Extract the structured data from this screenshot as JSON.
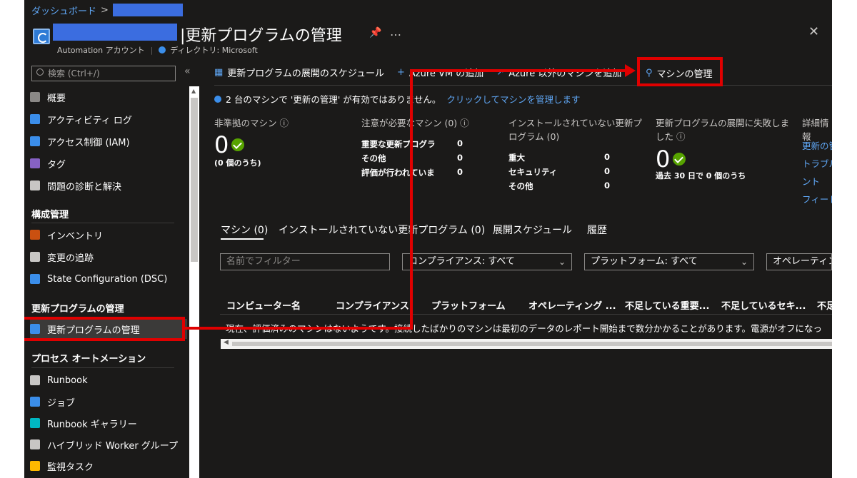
{
  "breadcrumb": {
    "home": "ダッシュボード",
    "sep": ">"
  },
  "header": {
    "title": "更新プログラムの管理",
    "title_prefix": "|",
    "resource_type": "Automation アカウント",
    "directory": "ディレクトリ: Microsoft",
    "pin_icon": "pin-icon",
    "more": "…",
    "close": "✕"
  },
  "sidebar": {
    "search_placeholder": "検索 (Ctrl+/)",
    "collapse": "«",
    "items_top": [
      {
        "label": "概要",
        "icon": "gear-icon",
        "color": "#8a8886"
      },
      {
        "label": "アクティビティ ログ",
        "icon": "log-icon",
        "color": "#3b8eea"
      },
      {
        "label": "アクセス制御 (IAM)",
        "icon": "people-icon",
        "color": "#3b8eea"
      },
      {
        "label": "タグ",
        "icon": "tag-icon",
        "color": "#8661c5"
      },
      {
        "label": "問題の診断と解決",
        "icon": "wrench-icon",
        "color": "#c8c6c4"
      }
    ],
    "section_config": "構成管理",
    "items_config": [
      {
        "label": "インベントリ",
        "icon": "inventory-icon",
        "color": "#ca5010"
      },
      {
        "label": "変更の追跡",
        "icon": "changes-icon",
        "color": "#c8c6c4"
      },
      {
        "label": "State Configuration (DSC)",
        "icon": "dsc-icon",
        "color": "#3b8eea"
      }
    ],
    "section_update": "更新プログラムの管理",
    "items_update": [
      {
        "label": "更新プログラムの管理",
        "icon": "update-icon",
        "color": "#3b8eea"
      }
    ],
    "section_process": "プロセス オートメーション",
    "items_process": [
      {
        "label": "Runbook",
        "icon": "runbook-icon",
        "color": "#c8c6c4"
      },
      {
        "label": "ジョブ",
        "icon": "jobs-icon",
        "color": "#3b8eea"
      },
      {
        "label": "Runbook ギャラリー",
        "icon": "gallery-icon",
        "color": "#00b7c3"
      },
      {
        "label": "ハイブリッド Worker グループ",
        "icon": "hybrid-icon",
        "color": "#c8c6c4"
      },
      {
        "label": "監視タスク",
        "icon": "watch-icon",
        "color": "#ffb900"
      }
    ]
  },
  "toolbar": {
    "schedule": "更新プログラムの展開のスケジュール",
    "add_azure_vm": "Azure VM の追加",
    "add_non_azure": "Azure 以外のマシンを追加",
    "manage_machines": "マシンの管理"
  },
  "notice": {
    "text": "2 台のマシンで '更新の管理' が有効ではありません。",
    "link": "クリックしてマシンを管理します"
  },
  "tiles": {
    "noncompliant": {
      "title": "非準拠のマシン",
      "value": "0",
      "sub": "(0 個のうち)"
    },
    "attention": {
      "title": "注意が必要なマシン (0)",
      "rows": [
        {
          "label": "重要な更新プログラ",
          "value": "0"
        },
        {
          "label": "その他",
          "value": "0"
        },
        {
          "label": "評価が行われていま",
          "value": "0"
        }
      ]
    },
    "missing": {
      "title_line1": "インストールされていない更新プ",
      "title_line2": "ログラム (0)",
      "rows": [
        {
          "label": "重大",
          "value": "0"
        },
        {
          "label": "セキュリティ",
          "value": "0"
        },
        {
          "label": "その他",
          "value": "0"
        }
      ]
    },
    "failed": {
      "title_line1": "更新プログラムの展開に失敗しま",
      "title_line2": "した",
      "value": "0",
      "sub": "過去 30 日で 0 個のうち"
    },
    "details": {
      "title": "詳細情報",
      "links": [
        "更新の管",
        "トラブル",
        "ント",
        "フィード"
      ]
    }
  },
  "tabs": [
    "マシン (0)",
    "インストールされていない更新プログラム (0)",
    "展開スケジュール",
    "履歴"
  ],
  "filters": {
    "name_placeholder": "名前でフィルター",
    "compliance": "コンプライアンス: すべて",
    "platform": "プラットフォーム: すべて",
    "os": "オペレーティン"
  },
  "table": {
    "columns": [
      "コンピューター名",
      "コンプライアンス",
      "プラットフォーム",
      "オペレーティング ...",
      "不足している重要...",
      "不足しているセキ...",
      "不足"
    ],
    "empty_message": "現在、評価済みのマシンはないようです。接続したばかりのマシンは最初のデータのレポート開始まで数分かかることがあります。電源がオフになっ"
  },
  "colors": {
    "annotation": "#e00000",
    "link": "#5fa6f4",
    "background": "#1b1a19"
  }
}
